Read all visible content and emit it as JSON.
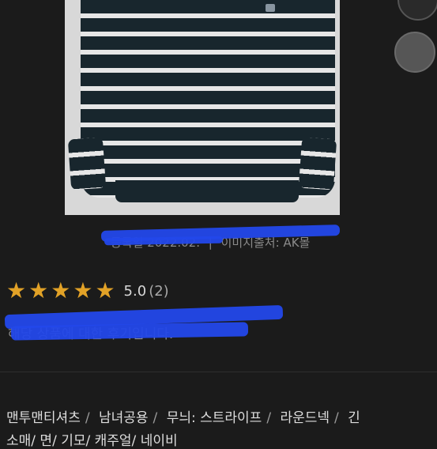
{
  "product": {
    "image_alt": "striped sweatshirt",
    "meta": {
      "date_label": "등록일",
      "date_value": "2022.02.",
      "source_label": "이미지출처",
      "source_value": "AK몰"
    }
  },
  "rating": {
    "stars": 5,
    "score": "5.0",
    "count": "(2)"
  },
  "review": {
    "text": "해당 상품에 대한 후기입니다."
  },
  "tags": {
    "row1": [
      "맨투맨티셔츠",
      "남녀공용",
      "무늬: 스트라이프",
      "라운드넥",
      "긴"
    ],
    "row2": [
      "소매",
      "면",
      "기모",
      "캐주얼",
      "네이비"
    ]
  },
  "colors": {
    "background": "#1b1b1b",
    "star": "#e2a227",
    "redaction": "#2348ea"
  }
}
